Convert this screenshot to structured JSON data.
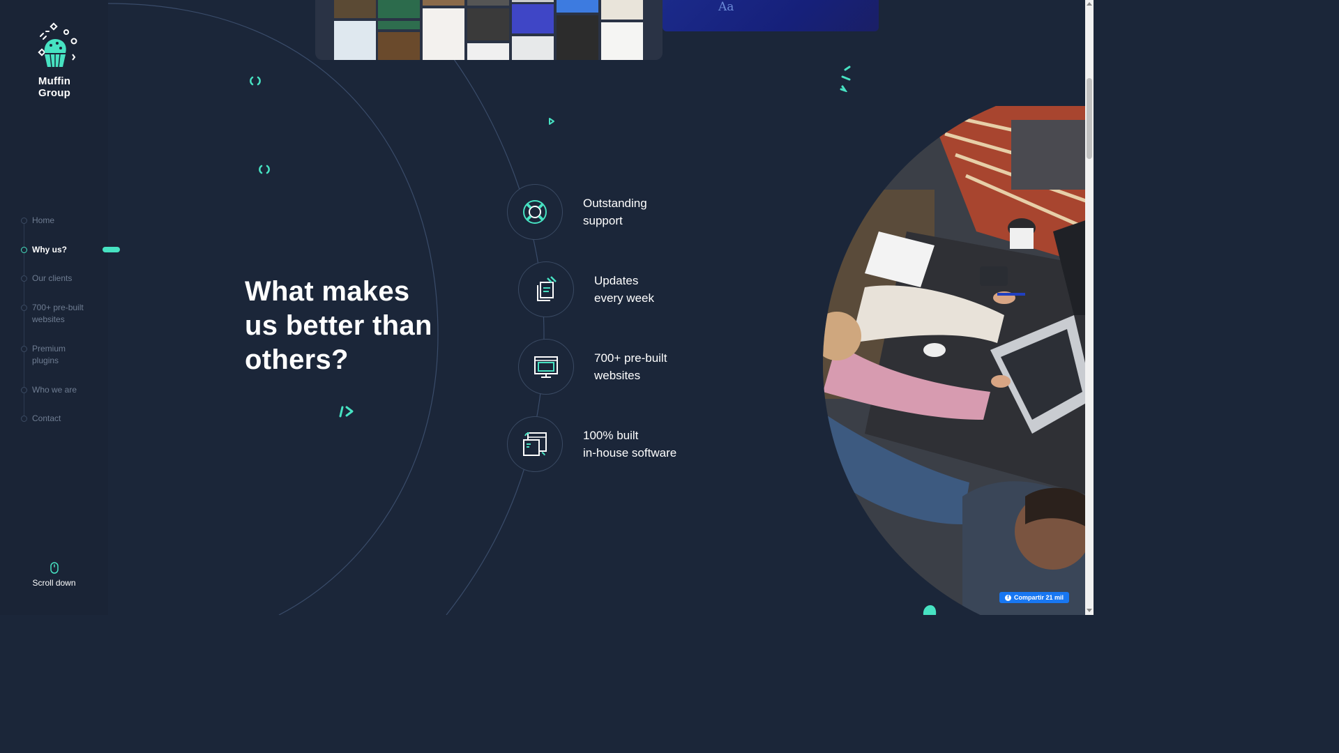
{
  "brand": {
    "name": "Muffin Group",
    "accent": "#47e2c2",
    "background": "#1b2639"
  },
  "nav": {
    "items": [
      {
        "label": "Home",
        "active": false
      },
      {
        "label": "Why us?",
        "active": true
      },
      {
        "label": "Our clients",
        "active": false
      },
      {
        "label": "700+ pre-built websites",
        "active": false
      },
      {
        "label": "Premium plugins",
        "active": false
      },
      {
        "label": "Who we are",
        "active": false
      },
      {
        "label": "Contact",
        "active": false
      }
    ]
  },
  "scroll": {
    "label": "Scroll down",
    "icon": "mouse-icon"
  },
  "hero": {
    "headline": "What makes us better than others?"
  },
  "features": [
    {
      "line1": "Outstanding",
      "line2": "support",
      "icon": "lifebuoy-icon"
    },
    {
      "line1": "Updates",
      "line2": "every week",
      "icon": "update-document-icon"
    },
    {
      "line1": "700+ pre-built",
      "line2": "websites",
      "icon": "monitor-icon"
    },
    {
      "line1": "100% built",
      "line2": "in-house software",
      "icon": "browser-sync-icon"
    }
  ],
  "preview": {
    "font_sample": "Aa"
  },
  "share": {
    "label": "Compartir 21 mil",
    "icon": "facebook-icon",
    "color": "#1877f2"
  }
}
